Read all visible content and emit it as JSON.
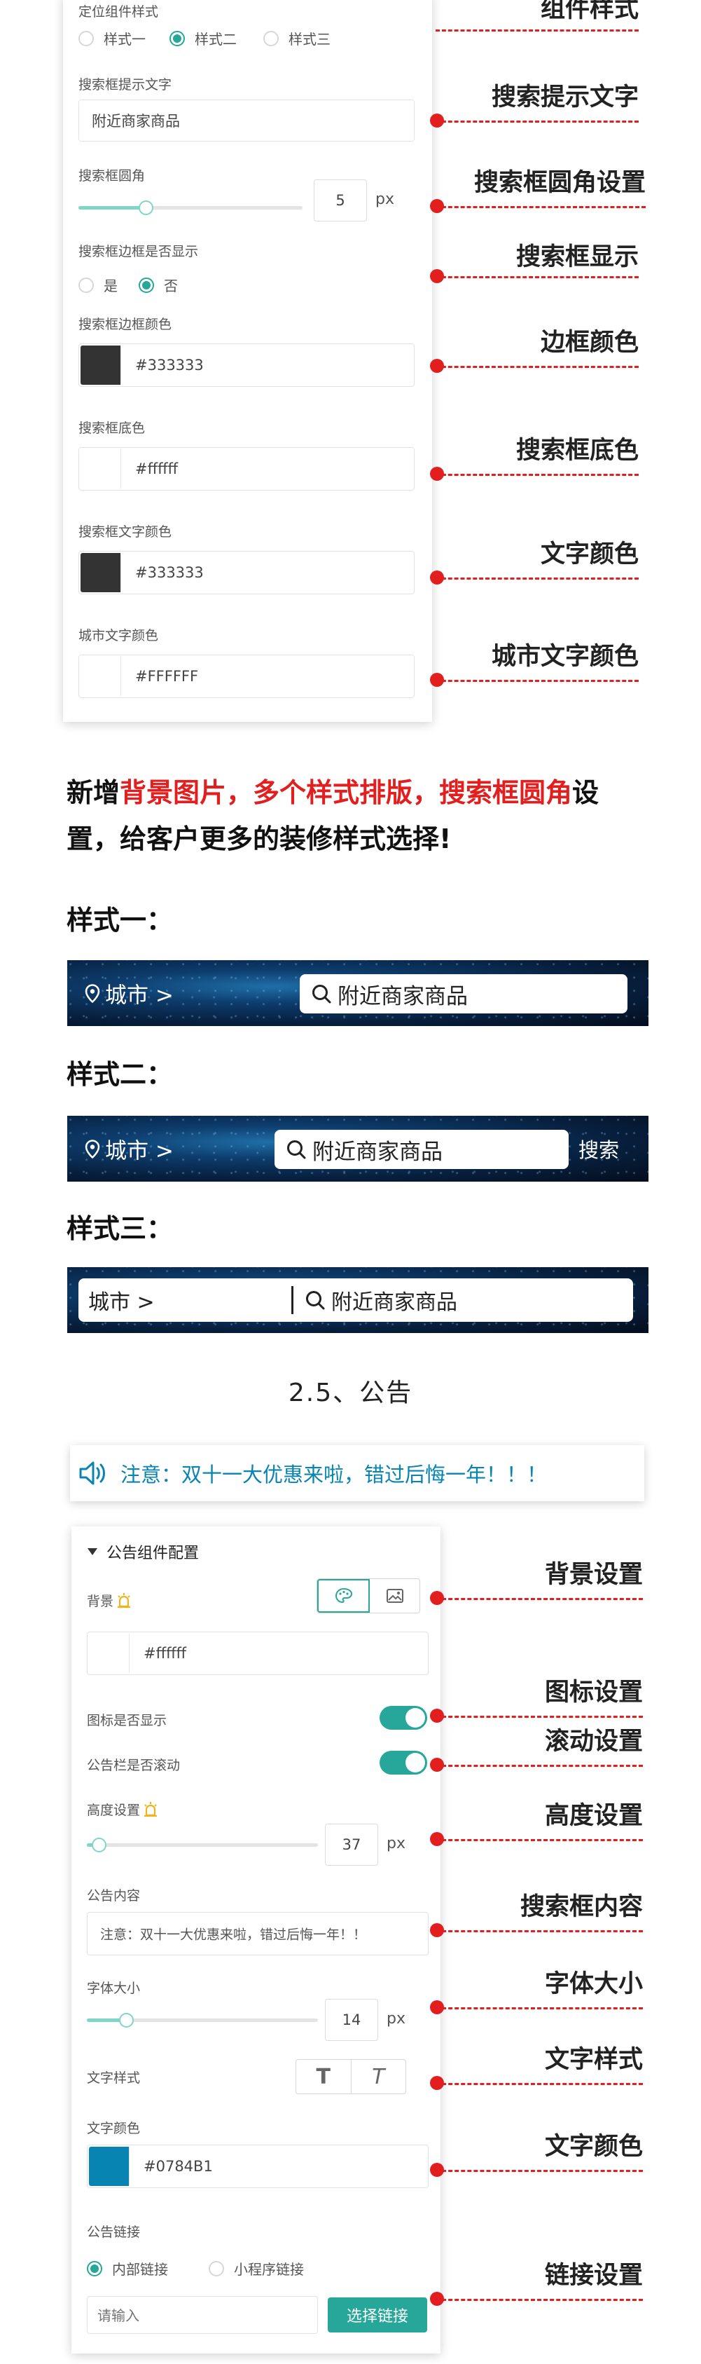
{
  "panel1": {
    "style_label": "定位组件样式",
    "style_options": [
      "样式一",
      "样式二",
      "样式三"
    ],
    "selected_style": "样式二",
    "placeholder_label": "搜索框提示文字",
    "placeholder_value": "附近商家商品",
    "radius_label": "搜索框圆角",
    "radius_value": "5",
    "radius_unit": "px",
    "radius_fraction": 0.3,
    "border_show_label": "搜索框边框是否显示",
    "border_options": [
      "是",
      "否"
    ],
    "border_selected": "否",
    "border_color_label": "搜索框边框颜色",
    "border_color_value": "#333333",
    "bg_color_label": "搜索框底色",
    "bg_color_value": "#ffffff",
    "text_color_label": "搜索框文字颜色",
    "text_color_value": "#333333",
    "city_color_label": "城市文字颜色",
    "city_color_value": "#FFFFFF"
  },
  "annotations1": [
    "组件样式",
    "搜索提示文字",
    "搜索框圆角设置",
    "搜索框显示",
    "边框颜色",
    "搜索框底色",
    "文字颜色",
    "城市文字颜色"
  ],
  "headline": {
    "line1_a": "新增",
    "line1_red": "背景图片，多个样式排版，搜索框圆角",
    "line1_b": "设",
    "line2": "置，给客户更多的装修样式选择!"
  },
  "styles": [
    {
      "label": "样式一：",
      "city": "城市 >",
      "search": "附近商家商品"
    },
    {
      "label": "样式二：",
      "city": "城市 >",
      "search": "附近商家商品",
      "button": "搜索"
    },
    {
      "label": "样式三：",
      "city": "城市 >",
      "search": "附近商家商品"
    }
  ],
  "section_title": "2.5、公告",
  "notice_text": "注意：双十一大优惠来啦，错过后悔一年！！！",
  "panel2": {
    "title": "公告组件配置",
    "bg_label": "背景",
    "bg_value": "#ffffff",
    "icon_show_label": "图标是否显示",
    "scroll_label": "公告栏是否滚动",
    "height_label": "高度设置",
    "height_value": "37",
    "height_unit": "px",
    "height_fraction": 0.05,
    "content_label": "公告内容",
    "content_value": "注意：双十一大优惠来啦，错过后悔一年！！",
    "font_size_label": "字体大小",
    "font_size_value": "14",
    "font_size_unit": "px",
    "font_size_fraction": 0.17,
    "text_style_label": "文字样式",
    "text_color_label": "文字颜色",
    "text_color_value": "#0784B1",
    "link_label": "公告链接",
    "link_options": [
      "内部链接",
      "小程序链接"
    ],
    "link_selected": "内部链接",
    "link_placeholder": "请输入",
    "link_button": "选择链接"
  },
  "annotations2": [
    "背景设置",
    "图标设置",
    "滚动设置",
    "高度设置",
    "搜索框内容",
    "字体大小",
    "文字样式",
    "文字颜色",
    "链接设置"
  ],
  "colors": {
    "accent": "#26a79a",
    "annotation": "#e21e1e",
    "notice": "#0784B1",
    "dark_swatch": "#333333"
  }
}
